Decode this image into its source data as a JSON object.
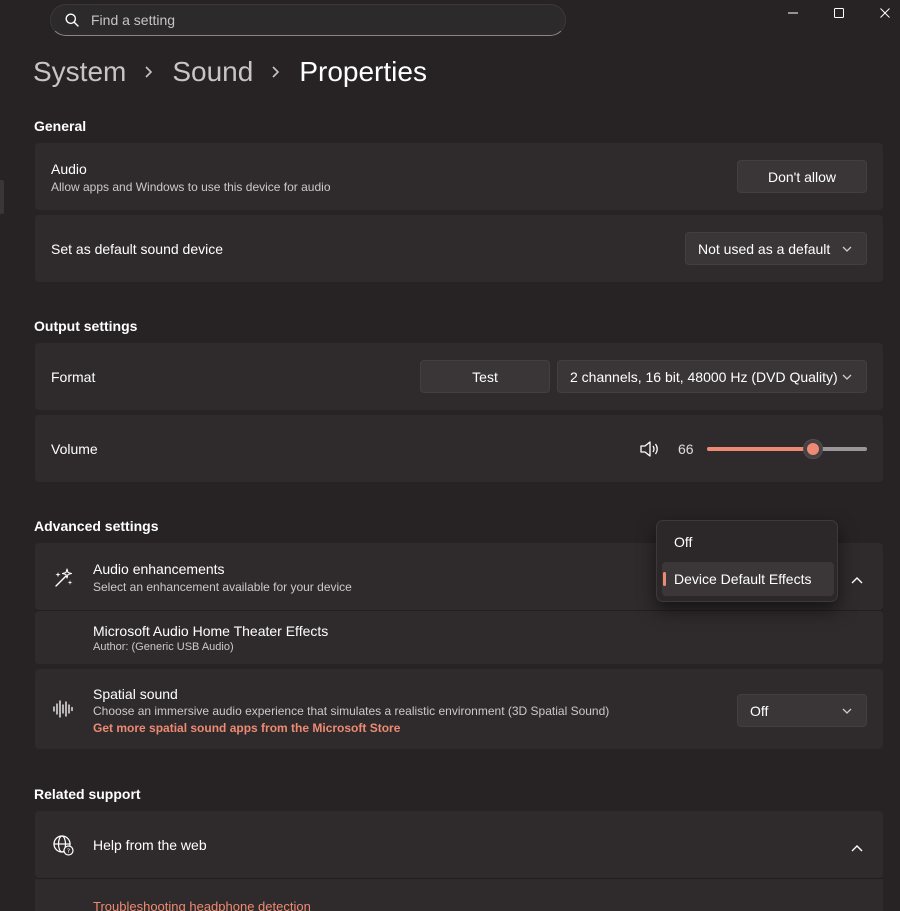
{
  "search": {
    "placeholder": "Find a setting"
  },
  "window": {
    "minimize": "minimize",
    "maximize": "maximize",
    "close": "close"
  },
  "breadcrumb": {
    "items": [
      "System",
      "Sound",
      "Properties"
    ]
  },
  "general": {
    "heading": "General",
    "audio": {
      "title": "Audio",
      "description": "Allow apps and Windows to use this device for audio",
      "button": "Don't allow"
    },
    "default_device": {
      "title": "Set as default sound device",
      "value": "Not used as a default"
    }
  },
  "output": {
    "heading": "Output settings",
    "format": {
      "title": "Format",
      "test_button": "Test",
      "value": "2 channels, 16 bit, 48000 Hz (DVD Quality)"
    },
    "volume": {
      "title": "Volume",
      "value": "66",
      "level_percent": 66
    }
  },
  "advanced": {
    "heading": "Advanced settings",
    "enhancements": {
      "title": "Audio enhancements",
      "description": "Select an enhancement available for your device",
      "dropdown_options": [
        "Off",
        "Device Default Effects"
      ],
      "selected": "Device Default Effects"
    },
    "effect": {
      "title": "Microsoft Audio Home Theater Effects",
      "author": "Author: (Generic USB Audio)"
    },
    "spatial": {
      "title": "Spatial sound",
      "description": "Choose an immersive audio experience that simulates a realistic environment (3D Spatial Sound)",
      "link": "Get more spatial sound apps from the Microsoft Store",
      "value": "Off"
    }
  },
  "related": {
    "heading": "Related support",
    "help": {
      "title": "Help from the web",
      "link": "Troubleshooting headphone detection"
    }
  },
  "colors": {
    "background": "#272324",
    "card": "#2f2b2c",
    "accent": "#ee8a74"
  }
}
